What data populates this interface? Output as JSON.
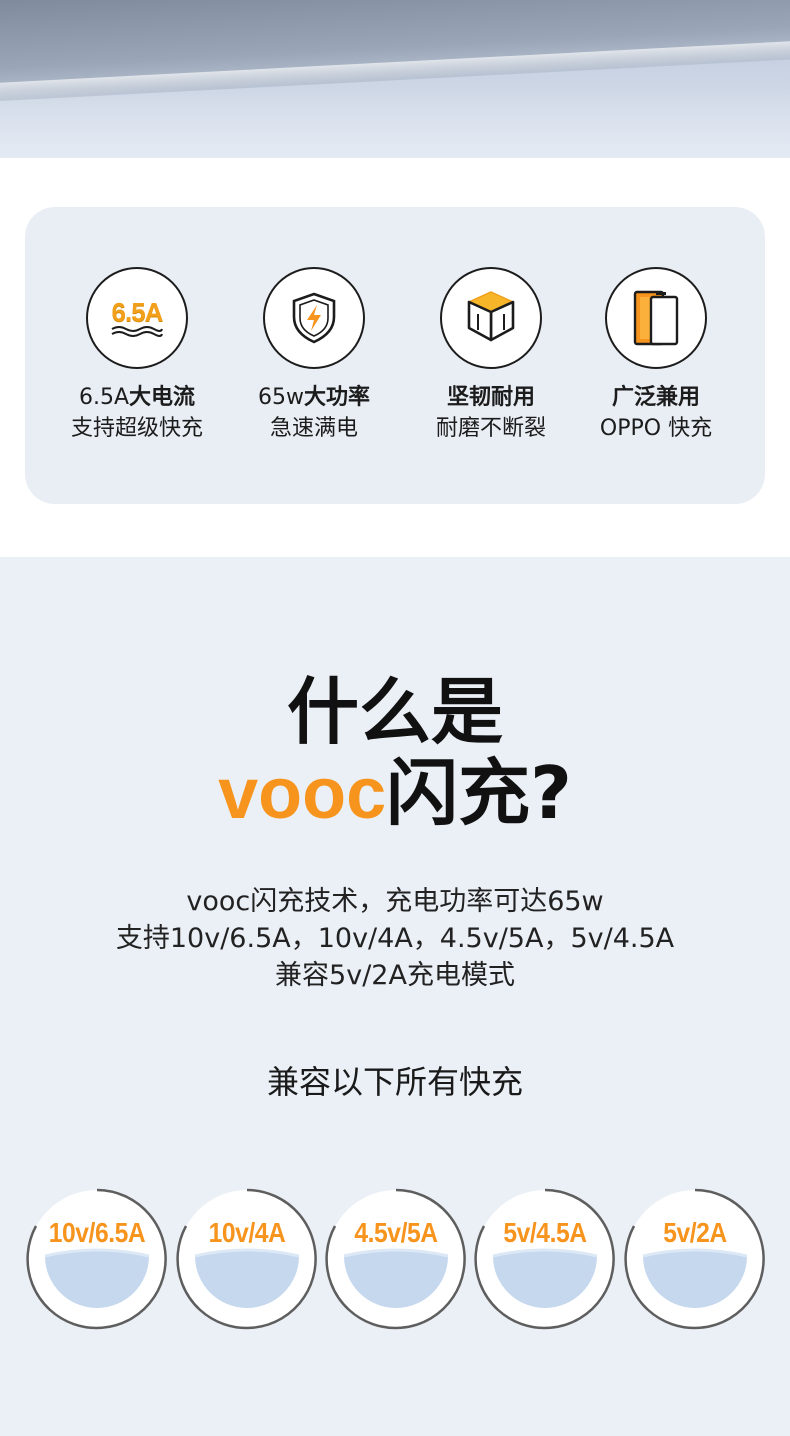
{
  "features": [
    {
      "icon": "amperage-6-5a-icon",
      "icon_text": "6.5A",
      "line1_prefix": "6.5A",
      "line1_bold": "大电流",
      "line2": "支持超级快充"
    },
    {
      "icon": "shield-lightning-icon",
      "line1_prefix": "65w",
      "line1_bold": "大功率",
      "line2": "急速满电"
    },
    {
      "icon": "cube-icon",
      "line1_prefix": "",
      "line1_bold": "坚韧耐用",
      "line2": "耐磨不断裂"
    },
    {
      "icon": "phone-icon",
      "line1_prefix": "",
      "line1_bold": "广泛兼用",
      "line2": "OPPO 快充"
    }
  ],
  "headline": {
    "line1": "什么是",
    "line2_accent": "vooc",
    "line2_rest": "闪充?"
  },
  "description": [
    "vooc闪充技术，充电功率可达65w",
    "支持10v/6.5A，10v/4A，4.5v/5A，5v/4.5A",
    "兼容5v/2A充电模式"
  ],
  "compat_title": "兼容以下所有快充",
  "modes": [
    "10v/6.5A",
    "10v/4A",
    "4.5v/5A",
    "5v/4.5A",
    "5v/2A"
  ],
  "colors": {
    "accent": "#f7941d",
    "card_bg": "#e9eef5",
    "section_bg": "#ebf0f6"
  }
}
